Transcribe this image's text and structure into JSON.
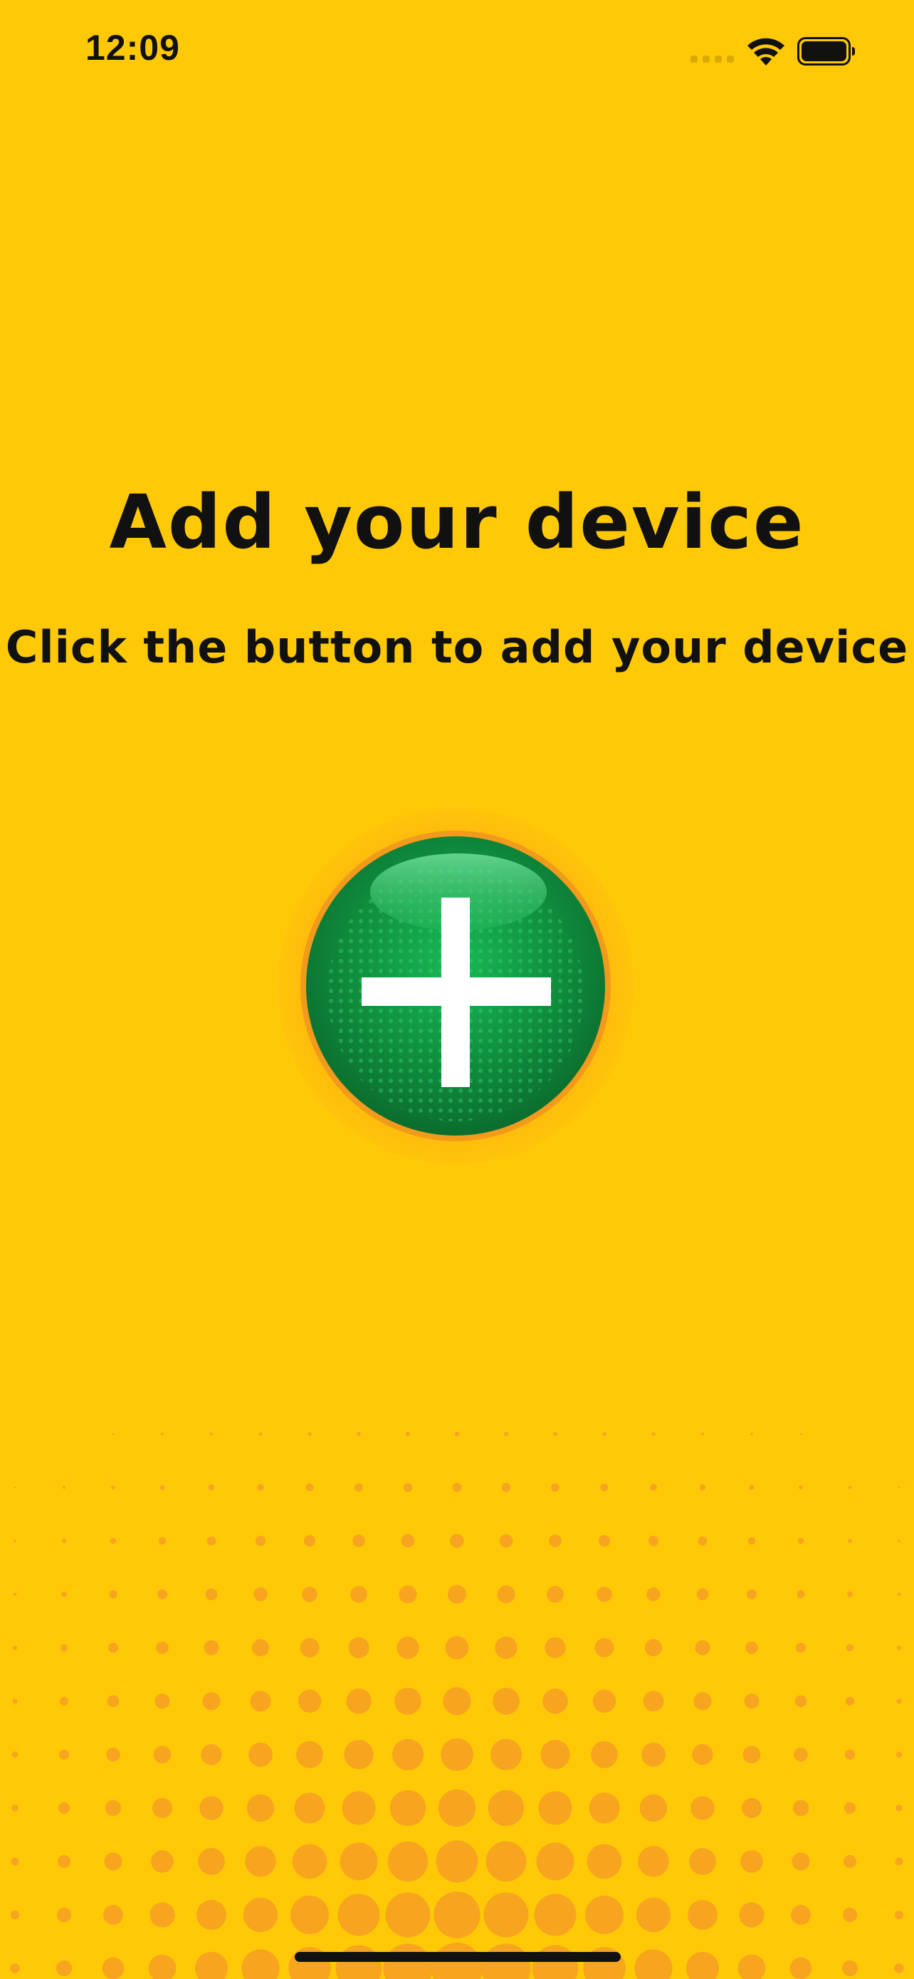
{
  "status_bar": {
    "time": "12:09",
    "icons": [
      "cellular-signal-icon",
      "wifi-icon",
      "battery-icon"
    ]
  },
  "main": {
    "title": "Add your device",
    "subtitle": "Click the button to add your device",
    "add_button_icon": "plus-icon"
  },
  "colors": {
    "background": "#FFC907",
    "dots": "#F7A41F",
    "button_green": "#0E8A3E",
    "button_ring": "#F5A623"
  }
}
